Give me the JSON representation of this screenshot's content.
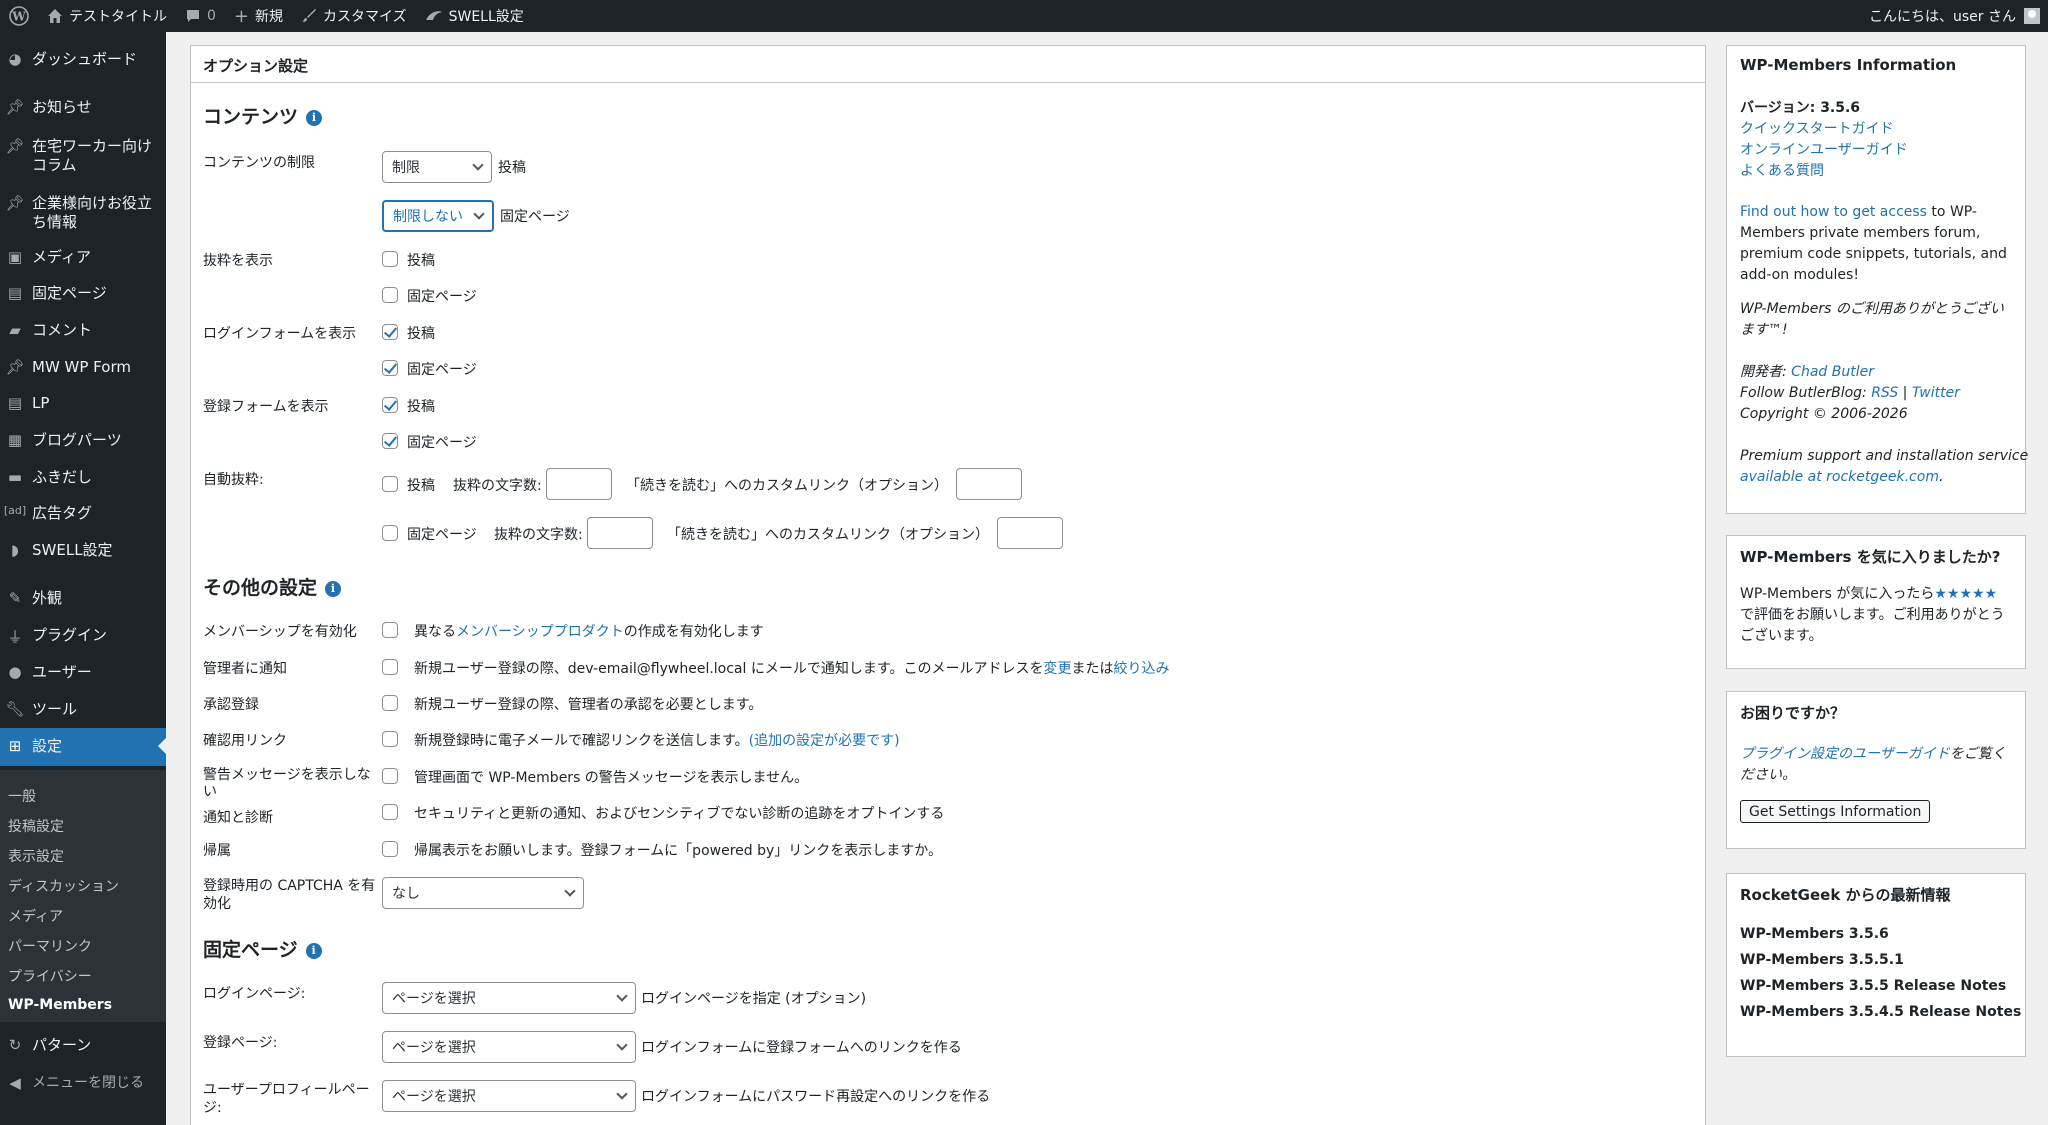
{
  "adminbar": {
    "site_title": "テストタイトル",
    "comments_count": "0",
    "new_label": "新規",
    "customize_label": "カスタマイズ",
    "swell_label": "SWELL設定",
    "greeting": "こんにちは、user さん"
  },
  "sidebar": {
    "items": [
      {
        "label": "ダッシュボード",
        "icon": "dashboard-icon"
      },
      {
        "label": "お知らせ",
        "icon": "pin-icon"
      },
      {
        "label": "在宅ワーカー向けコラム",
        "icon": "pin-icon"
      },
      {
        "label": "企業様向けお役立ち情報",
        "icon": "pin-icon"
      },
      {
        "label": "メディア",
        "icon": "media-icon"
      },
      {
        "label": "固定ページ",
        "icon": "page-icon"
      },
      {
        "label": "コメント",
        "icon": "comment-icon"
      },
      {
        "label": "MW WP Form",
        "icon": "pin-icon"
      },
      {
        "label": "LP",
        "icon": "page-icon"
      },
      {
        "label": "ブログパーツ",
        "icon": "grid-icon"
      },
      {
        "label": "ふきだし",
        "icon": "bubble-icon"
      },
      {
        "label": "広告タグ",
        "icon": "ad-icon"
      },
      {
        "label": "SWELL設定",
        "icon": "swell-icon"
      },
      {
        "label": "外観",
        "icon": "brush-icon"
      },
      {
        "label": "プラグイン",
        "icon": "plugin-icon"
      },
      {
        "label": "ユーザー",
        "icon": "user-icon"
      },
      {
        "label": "ツール",
        "icon": "wrench-icon"
      },
      {
        "label": "設定",
        "icon": "settings-icon"
      },
      {
        "label": "パターン",
        "icon": "pattern-icon"
      },
      {
        "label": "メニューを閉じる",
        "icon": "collapse-icon"
      }
    ],
    "submenu": [
      "一般",
      "投稿設定",
      "表示設定",
      "ディスカッション",
      "メディア",
      "パーマリンク",
      "プライバシー",
      "WP-Members"
    ]
  },
  "main": {
    "panel_title": "オプション設定",
    "content_section": {
      "title": "コンテンツ",
      "restrict_label": "コンテンツの制限",
      "restrict_posts_value": "制限",
      "restrict_posts_suffix": "投稿",
      "restrict_pages_value": "制限しない",
      "restrict_pages_suffix": "固定ページ",
      "excerpt_label": "抜粋を表示",
      "login_label": "ログインフォームを表示",
      "register_label": "登録フォームを表示",
      "auto_excerpt_label": "自動抜粋:",
      "post_label": "投稿",
      "page_label": "固定ページ",
      "excerpt_chars_label": "抜粋の文字数:",
      "read_more_label": "「続きを読む」へのカスタムリンク（オプション）",
      "checkboxes": {
        "excerpt_post": false,
        "excerpt_page": false,
        "login_post": true,
        "login_page": true,
        "register_post": true,
        "register_page": true,
        "auto_post": false,
        "auto_page": false
      }
    },
    "other_section": {
      "title": "その他の設定",
      "membership_label": "メンバーシップを有効化",
      "membership_pre": "異なる",
      "membership_link": "メンバーシッププロダクト",
      "membership_post": "の作成を有効化します",
      "notify_label": "管理者に通知",
      "notify_text": "新規ユーザー登録の際、dev-email@flywheel.local にメールで通知します。このメールアドレスを",
      "notify_link1": "変更",
      "notify_mid": "または",
      "notify_link2": "絞り込み",
      "approve_label": "承認登録",
      "approve_text": "新規ユーザー登録の際、管理者の承認を必要とします。",
      "confirm_label": "確認用リンク",
      "confirm_text": "新規登録時に電子メールで確認リンクを送信します。",
      "confirm_link": "(追加の設定が必要です)",
      "warning_label_1": "警告メッセージを表示しな",
      "warning_label_2": "い",
      "warning_text": "管理画面で WP-Members の警告メッセージを表示しません。",
      "diag_label": "通知と診断",
      "diag_text": "セキュリティと更新の通知、およびセンシティブでない診断の追跡をオプトインする",
      "attr_label": "帰属",
      "attr_text": "帰属表示をお願いします。登録フォームに「powered by」リンクを表示しますか。",
      "captcha_label_1": "登録時用の CAPTCHA を有",
      "captcha_label_2": "効化",
      "captcha_value": "なし"
    },
    "pages_section": {
      "title": "固定ページ",
      "login_page_label": "ログインページ:",
      "login_page_value": "ページを選択",
      "login_page_desc": "ログインページを指定 (オプション)",
      "register_page_label": "登録ページ:",
      "register_page_value": "ページを選択",
      "register_page_desc": "ログインフォームに登録フォームへのリンクを作る",
      "profile_page_label_1": "ユーザープロフィールペー",
      "profile_page_label_2": "ジ:",
      "profile_page_value": "ページを選択",
      "profile_page_desc": "ログインフォームにパスワード再設定へのリンクを作る"
    }
  },
  "right": {
    "info": {
      "title": "WP-Members Information",
      "version": "バージョン: 3.5.6",
      "link1": "クイックスタートガイド",
      "link2": "オンラインユーザーガイド",
      "link3": "よくある質問",
      "access_link": "Find out how to get access",
      "access_text_1": " to WP-",
      "access_text_2": "Members private members forum,",
      "access_text_3": "premium code snippets, tutorials, and",
      "access_text_4": "add-on modules!",
      "thanks_1": "WP-Members のご利用ありがとうござい",
      "thanks_2": "ます™!",
      "dev_label": "開発者: ",
      "dev_name": "Chad Butler",
      "follow": "Follow ButlerBlog: ",
      "rss": "RSS",
      "sep": " | ",
      "twitter": "Twitter",
      "copyright": "Copyright © 2006-2026",
      "premium_1": "Premium support and installation service",
      "premium_link": "available at rocketgeek.com",
      "premium_end": "."
    },
    "like": {
      "title": "WP-Members を気に入りましたか?",
      "text_1": "WP-Members が気に入ったら",
      "stars": "★★★★★",
      "text_2": "で評価をお願いします。ご利用ありがとう",
      "text_3": "ございます。"
    },
    "help": {
      "title": "お困りですか？",
      "link": "プラグイン設定のユーザーガイド",
      "text_1": "をご覧く",
      "text_2": "ださい。",
      "button": "Get Settings Information"
    },
    "news": {
      "title": "RocketGeek からの最新情報",
      "items": [
        "WP-Members 3.5.6",
        "WP-Members 3.5.5.1",
        "WP-Members 3.5.5 Release Notes",
        "WP-Members 3.5.4.5 Release Notes"
      ]
    }
  },
  "colors": {
    "admin_bar": "#1d2327",
    "menu_active": "#2271b1",
    "link": "#2271b1"
  }
}
